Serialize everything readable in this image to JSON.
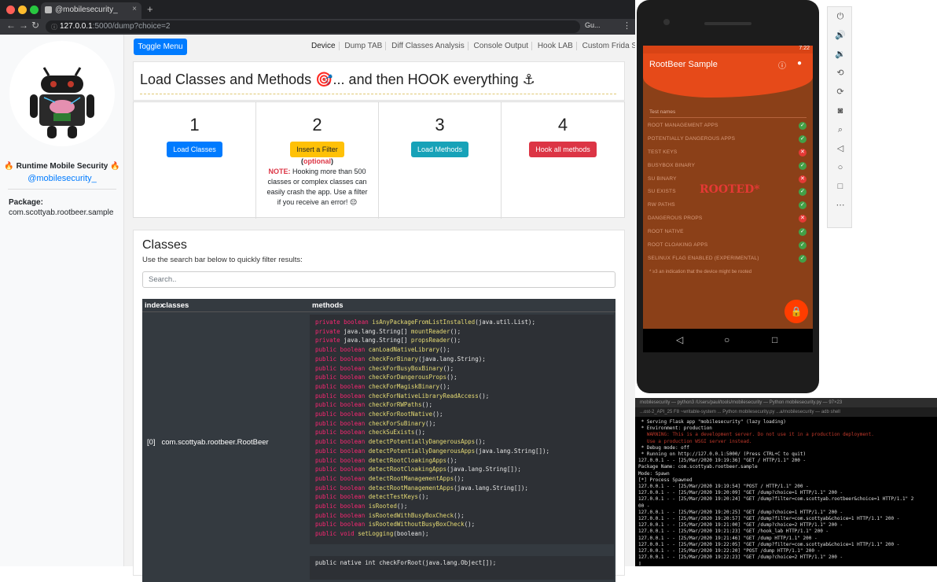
{
  "browser": {
    "tab_title": "@mobilesecurity_",
    "url_host": "127.0.0.1",
    "url_path": ":5000/dump?choice=2",
    "account": "Gu...",
    "new_tab": "+"
  },
  "sidebar": {
    "title": "🔥 Runtime Mobile Security 🔥",
    "handle": "@mobilesecurity_",
    "package_label": "Package:",
    "package_value": "com.scottyab.rootbeer.sample"
  },
  "topbar": {
    "toggle_label": "Toggle Menu",
    "nav": [
      "Device",
      "Dump TAB",
      "Diff Classes Analysis",
      "Console Output",
      "Hook LAB",
      "Custom Frida Script"
    ]
  },
  "header": {
    "title": "Load Classes and Methods 🎯... and then HOOK everything ⚓"
  },
  "steps": [
    {
      "num": "1",
      "button": "Load Classes",
      "color": "#007bff"
    },
    {
      "num": "2",
      "button": "Insert a Filter",
      "color": "#ffc107",
      "optional_open": "(",
      "optional": "optional",
      "optional_close": ")",
      "note_label": "NOTE:",
      "note": " Hooking more than 500 classes or complex classes can easily crash the app. Use a filter if you receive an error! 😔"
    },
    {
      "num": "3",
      "button": "Load Methods",
      "color": "#17a2b8"
    },
    {
      "num": "4",
      "button": "Hook all methods",
      "color": "#dc3545"
    }
  ],
  "classes": {
    "title": "Classes",
    "description": "Use the search bar below to quickly filter results:",
    "search_placeholder": "Search..",
    "col_index": "index",
    "col_classes": "classes",
    "col_methods": "methods",
    "row_index": "[0]",
    "row_class": "com.scottyab.rootbeer.RootBeer",
    "methods": [
      [
        "private",
        "boolean",
        "isAnyPackageFromListInstalled",
        "(java.util.List);"
      ],
      [
        "private",
        "java.lang.String[]",
        "mountReader",
        "();"
      ],
      [
        "private",
        "java.lang.String[]",
        "propsReader",
        "();"
      ],
      [
        "public",
        "boolean",
        "canLoadNativeLibrary",
        "();"
      ],
      [
        "public",
        "boolean",
        "checkForBinary",
        "(java.lang.String);"
      ],
      [
        "public",
        "boolean",
        "checkForBusyBoxBinary",
        "();"
      ],
      [
        "public",
        "boolean",
        "checkForDangerousProps",
        "();"
      ],
      [
        "public",
        "boolean",
        "checkForMagiskBinary",
        "();"
      ],
      [
        "public",
        "boolean",
        "checkForNativeLibraryReadAccess",
        "();"
      ],
      [
        "public",
        "boolean",
        "checkForRWPaths",
        "();"
      ],
      [
        "public",
        "boolean",
        "checkForRootNative",
        "();"
      ],
      [
        "public",
        "boolean",
        "checkForSuBinary",
        "();"
      ],
      [
        "public",
        "boolean",
        "checkSuExists",
        "();"
      ],
      [
        "public",
        "boolean",
        "detectPotentiallyDangerousApps",
        "();"
      ],
      [
        "public",
        "boolean",
        "detectPotentiallyDangerousApps",
        "(java.lang.String[]);"
      ],
      [
        "public",
        "boolean",
        "detectRootCloakingApps",
        "();"
      ],
      [
        "public",
        "boolean",
        "detectRootCloakingApps",
        "(java.lang.String[]);"
      ],
      [
        "public",
        "boolean",
        "detectRootManagementApps",
        "();"
      ],
      [
        "public",
        "boolean",
        "detectRootManagementApps",
        "(java.lang.String[]);"
      ],
      [
        "public",
        "boolean",
        "detectTestKeys",
        "();"
      ],
      [
        "public",
        "boolean",
        "isRooted",
        "();"
      ],
      [
        "public",
        "boolean",
        "isRootedWithBusyBoxCheck",
        "();"
      ],
      [
        "public",
        "boolean",
        "isRootedWithoutBusyBoxCheck",
        "();"
      ],
      [
        "public",
        "void",
        "setLogging",
        "(boolean);"
      ]
    ],
    "next_method": "public native int checkForRoot(java.lang.Object[]);"
  },
  "phone": {
    "time": "7:22",
    "app_title": "RootBeer Sample",
    "list_header": "Test names",
    "checks": [
      {
        "label": "ROOT MANAGEMENT APPS",
        "ok": true
      },
      {
        "label": "POTENTIALLY DANGEROUS APPS",
        "ok": true
      },
      {
        "label": "TEST KEYS",
        "ok": false
      },
      {
        "label": "BUSYBOX BINARY",
        "ok": true
      },
      {
        "label": "SU BINARY",
        "ok": false
      },
      {
        "label": "SU EXISTS",
        "ok": true
      },
      {
        "label": "RW PATHS",
        "ok": true
      },
      {
        "label": "DANGEROUS PROPS",
        "ok": false
      },
      {
        "label": "ROOT NATIVE",
        "ok": true
      },
      {
        "label": "ROOT CLOAKING APPS",
        "ok": true
      },
      {
        "label": "SELINUX FLAG ENABLED (EXPERIMENTAL)",
        "ok": true
      }
    ],
    "rooted_label": "ROOTED*",
    "footnote": "* ≥3 an indication that the device might be rooted",
    "ok_color": "#43a047",
    "fail_color": "#e53935"
  },
  "terminal": {
    "title": "mobilesecurity — python3 /Users/paul/tools/mobilesecurity — Python mobilesecurity.py — 97×23",
    "tabs": "...ost-2_API_25 F8 ~writable-system      ... Python mobilesecurity.py      ...a/mobilesecurity — adb shell",
    "lines": [
      " * Serving Flask app \"mobilesecurity\" (lazy loading)",
      " * Environment: production",
      "   WARNING: This is a development server. Do not use it in a production deployment.",
      "   Use a production WSGI server instead.",
      " * Debug mode: off",
      " * Running on http://127.0.0.1:5000/ (Press CTRL+C to quit)",
      "127.0.0.1 - - [25/Mar/2020 19:19:36] \"GET / HTTP/1.1\" 200 -",
      "Package Name: com.scottyab.rootbeer.sample",
      "Mode: Spawn",
      "[*] Process Spawned",
      "127.0.0.1 - - [25/Mar/2020 19:19:54] \"POST / HTTP/1.1\" 200 -",
      "127.0.0.1 - - [25/Mar/2020 19:20:09] \"GET /dump?choice=1 HTTP/1.1\" 200 -",
      "127.0.0.1 - - [25/Mar/2020 19:20:24] \"GET /dump?filter=com.scottyab.rootbeer&choice=1 HTTP/1.1\" 2",
      "00 -",
      "127.0.0.1 - - [25/Mar/2020 19:20:25] \"GET /dump?choice=1 HTTP/1.1\" 200 -",
      "127.0.0.1 - - [25/Mar/2020 19:20:57] \"GET /dump?filter=com.scottyab&choice=1 HTTP/1.1\" 200 -",
      "127.0.0.1 - - [25/Mar/2020 19:21:00] \"GET /dump?choice=2 HTTP/1.1\" 200 -",
      "127.0.0.1 - - [25/Mar/2020 19:21:23] \"GET /hook_lab HTTP/1.1\" 200 -",
      "127.0.0.1 - - [25/Mar/2020 19:21:46] \"GET /dump HTTP/1.1\" 200 -",
      "127.0.0.1 - - [25/Mar/2020 19:22:05] \"GET /dump?filter=com.scottyab&choice=1 HTTP/1.1\" 200 -",
      "127.0.0.1 - - [25/Mar/2020 19:22:20] \"POST /dump HTTP/1.1\" 200 -",
      "127.0.0.1 - - [25/Mar/2020 19:22:23] \"GET /dump?choice=2 HTTP/1.1\" 200 -",
      "▯"
    ]
  }
}
